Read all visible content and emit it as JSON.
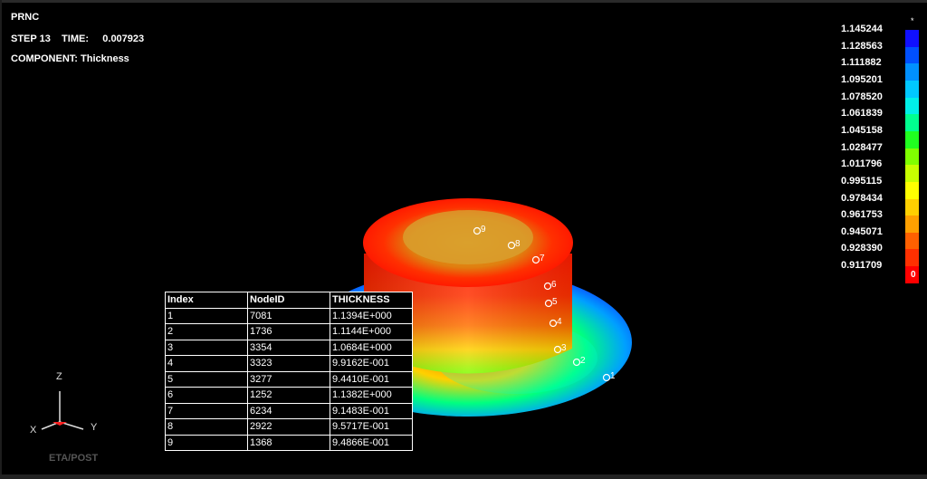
{
  "header": {
    "title": "PRNC",
    "step_line": "STEP 13    TIME:     0.007923",
    "component_line": "COMPONENT: Thickness"
  },
  "colorbar": {
    "top_marker": "*",
    "bottom_marker": "0",
    "levels": [
      "1.145244",
      "1.128563",
      "1.111882",
      "1.095201",
      "1.078520",
      "1.061839",
      "1.045158",
      "1.028477",
      "1.011796",
      "0.995115",
      "0.978434",
      "0.961753",
      "0.945071",
      "0.928390",
      "0.911709"
    ],
    "colors": [
      "#1010ff",
      "#0050ff",
      "#0090ff",
      "#00c8ff",
      "#00f0e8",
      "#00ff90",
      "#20ff20",
      "#80ff00",
      "#c8ff00",
      "#ffff00",
      "#ffd000",
      "#ffa000",
      "#ff6000",
      "#ff3000",
      "#ff0000"
    ]
  },
  "markers": [
    "1",
    "2",
    "3",
    "4",
    "5",
    "6",
    "7",
    "8",
    "9"
  ],
  "table": {
    "headers": [
      "Index",
      "NodeID",
      "THICKNESS"
    ],
    "rows": [
      [
        "1",
        "7081",
        "1.1394E+000"
      ],
      [
        "2",
        "1736",
        "1.1144E+000"
      ],
      [
        "3",
        "3354",
        "1.0684E+000"
      ],
      [
        "4",
        "3323",
        "9.9162E-001"
      ],
      [
        "5",
        "3277",
        "9.4410E-001"
      ],
      [
        "6",
        "1252",
        "1.1382E+000"
      ],
      [
        "7",
        "6234",
        "9.1483E-001"
      ],
      [
        "8",
        "2922",
        "9.5717E-001"
      ],
      [
        "9",
        "1368",
        "9.4866E-001"
      ]
    ]
  },
  "axes": {
    "z": "Z",
    "x": "X",
    "y": "Y"
  },
  "brand": "ETA/POST"
}
